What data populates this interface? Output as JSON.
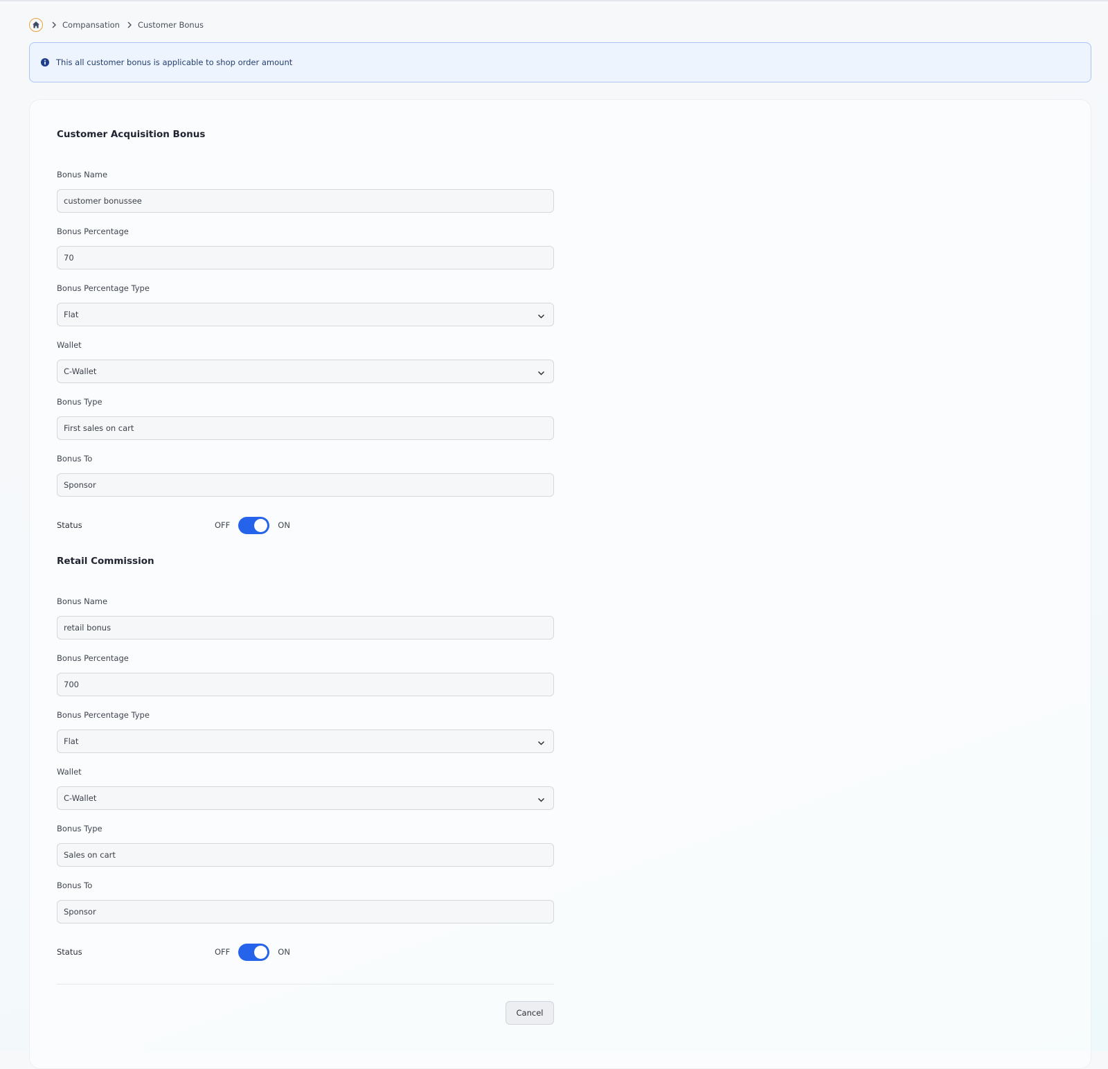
{
  "breadcrumb": {
    "items": [
      "Compansation",
      "Customer Bonus"
    ]
  },
  "alert": {
    "text": "This all customer bonus is applicable to shop order amount"
  },
  "sections": [
    {
      "title": "Customer Acquisition Bonus",
      "fields": [
        {
          "label": "Bonus Name",
          "value": "customer bonussee"
        },
        {
          "label": "Bonus Percentage",
          "value": "70"
        },
        {
          "label": "Bonus Percentage Type",
          "value": "Flat"
        },
        {
          "label": "Wallet",
          "value": "C-Wallet"
        },
        {
          "label": "Bonus Type",
          "value": "First sales on cart"
        },
        {
          "label": "Bonus To",
          "value": "Sponsor"
        }
      ],
      "status": {
        "label": "Status",
        "off": "OFF",
        "on": "ON",
        "enabled": true
      }
    },
    {
      "title": "Retail Commission",
      "fields": [
        {
          "label": "Bonus Name",
          "value": "retail bonus"
        },
        {
          "label": "Bonus Percentage",
          "value": "700"
        },
        {
          "label": "Bonus Percentage Type",
          "value": "Flat"
        },
        {
          "label": "Wallet",
          "value": "C-Wallet"
        },
        {
          "label": "Bonus Type",
          "value": "Sales on cart"
        },
        {
          "label": "Bonus To",
          "value": "Sponsor"
        }
      ],
      "status": {
        "label": "Status",
        "off": "OFF",
        "on": "ON",
        "enabled": true
      }
    }
  ],
  "actions": {
    "cancel_label": "Cancel"
  },
  "colors": {
    "accent": "#2563eb",
    "alert_border": "#a9c4f5",
    "alert_bg": "#eef4fe",
    "home_icon": "#e9a23b"
  },
  "icons": {
    "home": "home-icon",
    "breadcrumb_separator": "chevron-right-icon",
    "alert": "info-icon",
    "select": "chevron-down-icon"
  }
}
